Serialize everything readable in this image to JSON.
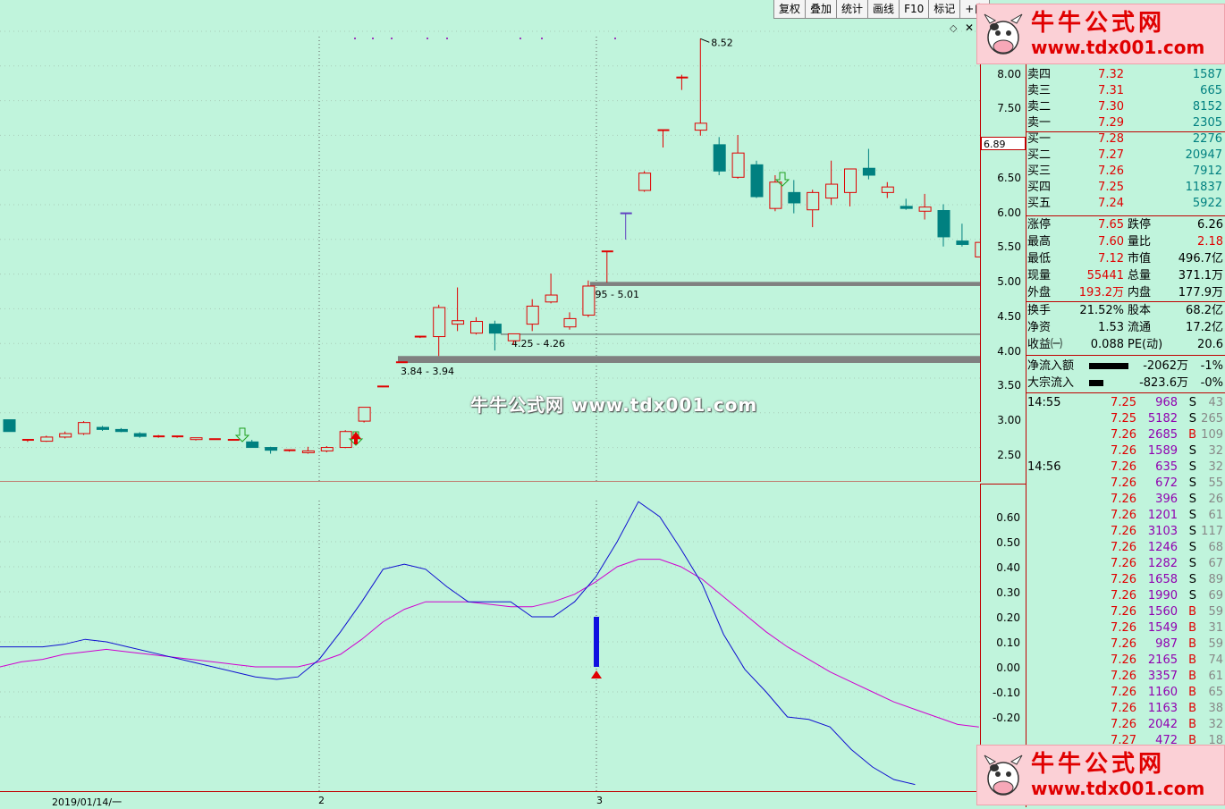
{
  "toolbar": [
    "复权",
    "叠加",
    "统计",
    "画线",
    "F10",
    "标记",
    "+自"
  ],
  "kchart": {
    "price_axis": [
      "8.00",
      "7.50",
      "7.00",
      "6.50",
      "6.00",
      "5.50",
      "5.00",
      "4.50",
      "4.00",
      "3.50",
      "3.00",
      "2.50"
    ],
    "current_price": "6.89",
    "high_label": "8.52",
    "gap_labels": [
      "4.95 - 5.01",
      "4.25 - 4.26",
      "3.84 - 3.94"
    ],
    "watermark": "牛牛公式网 www.tdx001.com"
  },
  "indicator": {
    "axis": [
      "0.60",
      "0.50",
      "0.40",
      "0.30",
      "0.20",
      "0.10",
      "0.00",
      "-0.10",
      "-0.20"
    ]
  },
  "dates": [
    "2019/01/14/一",
    "2",
    "3"
  ],
  "quote": {
    "rows": [
      {
        "label": "卖四",
        "price": "7.32",
        "vol": "1587"
      },
      {
        "label": "卖三",
        "price": "7.31",
        "vol": "665"
      },
      {
        "label": "卖二",
        "price": "7.30",
        "vol": "8152"
      },
      {
        "label": "卖一",
        "price": "7.29",
        "vol": "2305"
      },
      {
        "label": "买一",
        "price": "7.28",
        "vol": "2276"
      },
      {
        "label": "买二",
        "price": "7.27",
        "vol": "20947"
      },
      {
        "label": "买三",
        "price": "7.26",
        "vol": "7912"
      },
      {
        "label": "买四",
        "price": "7.25",
        "vol": "11837"
      },
      {
        "label": "买五",
        "price": "7.24",
        "vol": "5922"
      }
    ],
    "stats": [
      {
        "l1": "涨停",
        "v1": "7.65",
        "l2": "跌停",
        "v2": "6.26"
      },
      {
        "l1": "最高",
        "v1": "7.60",
        "l2": "量比",
        "v2": "2.18"
      },
      {
        "l1": "最低",
        "v1": "7.12",
        "l2": "市值",
        "v2": "496.7亿"
      },
      {
        "l1": "现量",
        "v1": "55441",
        "l2": "总量",
        "v2": "371.1万"
      },
      {
        "l1": "外盘",
        "v1": "193.2万",
        "l2": "内盘",
        "v2": "177.9万"
      }
    ],
    "stats2": [
      {
        "l1": "换手",
        "v1": "21.52%",
        "l2": "股本",
        "v2": "68.2亿"
      },
      {
        "l1": "净资",
        "v1": "1.53",
        "l2": "流通",
        "v2": "17.2亿"
      },
      {
        "l1": "收益㈠",
        "v1": "0.088",
        "l2": "PE(动)",
        "v2": "20.6"
      }
    ],
    "flows": [
      {
        "label": "净流入额",
        "value": "-2062万",
        "pct": "-1%"
      },
      {
        "label": "大宗流入",
        "value": "-823.6万",
        "pct": "-0%"
      }
    ]
  },
  "ticks": [
    {
      "time": "14:55",
      "price": "7.25",
      "vol": "968",
      "bs": "S",
      "n": "43"
    },
    {
      "time": "",
      "price": "7.25",
      "vol": "5182",
      "bs": "S",
      "n": "265"
    },
    {
      "time": "",
      "price": "7.26",
      "vol": "2685",
      "bs": "B",
      "n": "109"
    },
    {
      "time": "",
      "price": "7.26",
      "vol": "1589",
      "bs": "S",
      "n": "32"
    },
    {
      "time": "14:56",
      "price": "7.26",
      "vol": "635",
      "bs": "S",
      "n": "32"
    },
    {
      "time": "",
      "price": "7.26",
      "vol": "672",
      "bs": "S",
      "n": "55"
    },
    {
      "time": "",
      "price": "7.26",
      "vol": "396",
      "bs": "S",
      "n": "26"
    },
    {
      "time": "",
      "price": "7.26",
      "vol": "1201",
      "bs": "S",
      "n": "61"
    },
    {
      "time": "",
      "price": "7.26",
      "vol": "3103",
      "bs": "S",
      "n": "117"
    },
    {
      "time": "",
      "price": "7.26",
      "vol": "1246",
      "bs": "S",
      "n": "68"
    },
    {
      "time": "",
      "price": "7.26",
      "vol": "1282",
      "bs": "S",
      "n": "67"
    },
    {
      "time": "",
      "price": "7.26",
      "vol": "1658",
      "bs": "S",
      "n": "89"
    },
    {
      "time": "",
      "price": "7.26",
      "vol": "1990",
      "bs": "S",
      "n": "69"
    },
    {
      "time": "",
      "price": "7.26",
      "vol": "1560",
      "bs": "B",
      "n": "59"
    },
    {
      "time": "",
      "price": "7.26",
      "vol": "1549",
      "bs": "B",
      "n": "31"
    },
    {
      "time": "",
      "price": "7.26",
      "vol": "987",
      "bs": "B",
      "n": "59"
    },
    {
      "time": "",
      "price": "7.26",
      "vol": "2165",
      "bs": "B",
      "n": "74"
    },
    {
      "time": "",
      "price": "7.26",
      "vol": "3357",
      "bs": "B",
      "n": "61"
    },
    {
      "time": "",
      "price": "7.26",
      "vol": "1160",
      "bs": "B",
      "n": "65"
    },
    {
      "time": "",
      "price": "7.26",
      "vol": "1163",
      "bs": "B",
      "n": "38"
    },
    {
      "time": "",
      "price": "7.26",
      "vol": "2042",
      "bs": "B",
      "n": "32"
    },
    {
      "time": "",
      "price": "7.27",
      "vol": "472",
      "bs": "B",
      "n": "18"
    }
  ],
  "watermark": {
    "title": "牛牛公式网",
    "url": "www.tdx001.com"
  },
  "candles": [
    {
      "o": 3.02,
      "h": 3.02,
      "l": 2.85,
      "c": 2.85
    },
    {
      "o": 2.72,
      "h": 2.74,
      "l": 2.7,
      "c": 2.73
    },
    {
      "o": 2.71,
      "h": 2.79,
      "l": 2.7,
      "c": 2.77
    },
    {
      "o": 2.77,
      "h": 2.85,
      "l": 2.75,
      "c": 2.82
    },
    {
      "o": 2.82,
      "h": 3.0,
      "l": 2.8,
      "c": 2.98
    },
    {
      "o": 2.91,
      "h": 2.93,
      "l": 2.86,
      "c": 2.88
    },
    {
      "o": 2.88,
      "h": 2.9,
      "l": 2.84,
      "c": 2.85
    },
    {
      "o": 2.82,
      "h": 2.84,
      "l": 2.76,
      "c": 2.78
    },
    {
      "o": 2.78,
      "h": 2.8,
      "l": 2.76,
      "c": 2.78
    },
    {
      "o": 2.78,
      "h": 2.79,
      "l": 2.76,
      "c": 2.78
    },
    {
      "o": 2.74,
      "h": 2.76,
      "l": 2.72,
      "c": 2.76
    },
    {
      "o": 2.74,
      "h": 2.75,
      "l": 2.73,
      "c": 2.74
    },
    {
      "o": 2.73,
      "h": 2.74,
      "l": 2.72,
      "c": 2.73
    },
    {
      "o": 2.7,
      "h": 2.73,
      "l": 2.62,
      "c": 2.62
    },
    {
      "o": 2.62,
      "h": 2.63,
      "l": 2.53,
      "c": 2.58
    },
    {
      "o": 2.57,
      "h": 2.59,
      "l": 2.56,
      "c": 2.58
    },
    {
      "o": 2.55,
      "h": 2.63,
      "l": 2.53,
      "c": 2.57
    },
    {
      "o": 2.57,
      "h": 2.64,
      "l": 2.55,
      "c": 2.62
    },
    {
      "o": 2.62,
      "h": 2.87,
      "l": 2.61,
      "c": 2.85
    },
    {
      "o": 3.0,
      "h": 3.2,
      "l": 2.98,
      "c": 3.2
    },
    {
      "o": 3.49,
      "h": 3.5,
      "l": 3.49,
      "c": 3.5
    },
    {
      "o": 3.85,
      "h": 3.86,
      "l": 3.84,
      "c": 3.85
    },
    {
      "o": 4.22,
      "h": 4.23,
      "l": 4.2,
      "c": 4.22
    },
    {
      "o": 4.22,
      "h": 4.68,
      "l": 3.94,
      "c": 4.64
    },
    {
      "o": 4.4,
      "h": 4.93,
      "l": 4.3,
      "c": 4.45
    },
    {
      "o": 4.27,
      "h": 4.5,
      "l": 4.25,
      "c": 4.44
    },
    {
      "o": 4.4,
      "h": 4.45,
      "l": 4.02,
      "c": 4.27
    },
    {
      "o": 4.16,
      "h": 4.26,
      "l": 4.1,
      "c": 4.26
    },
    {
      "o": 4.4,
      "h": 4.76,
      "l": 4.3,
      "c": 4.66
    },
    {
      "o": 4.72,
      "h": 5.13,
      "l": 4.7,
      "c": 4.82
    },
    {
      "o": 4.36,
      "h": 4.57,
      "l": 4.32,
      "c": 4.48
    },
    {
      "o": 4.53,
      "h": 5.03,
      "l": 4.5,
      "c": 4.95
    },
    {
      "o": 5.45,
      "h": 5.45,
      "l": 5.0,
      "c": 5.45
    },
    {
      "o": 6.0,
      "h": 6.0,
      "l": 5.62,
      "c": 6.0
    },
    {
      "o": 6.33,
      "h": 6.61,
      "l": 6.31,
      "c": 6.58
    },
    {
      "o": 7.2,
      "h": 7.2,
      "l": 6.95,
      "c": 7.2
    },
    {
      "o": 7.96,
      "h": 8.0,
      "l": 7.78,
      "c": 7.96
    },
    {
      "o": 7.2,
      "h": 8.52,
      "l": 7.12,
      "c": 7.3
    },
    {
      "o": 6.99,
      "h": 7.1,
      "l": 6.55,
      "c": 6.61
    },
    {
      "o": 6.52,
      "h": 7.13,
      "l": 6.5,
      "c": 6.87
    },
    {
      "o": 6.7,
      "h": 6.76,
      "l": 6.22,
      "c": 6.24
    },
    {
      "o": 6.07,
      "h": 6.55,
      "l": 6.03,
      "c": 6.45
    },
    {
      "o": 6.3,
      "h": 6.48,
      "l": 6.0,
      "c": 6.15
    },
    {
      "o": 6.05,
      "h": 6.34,
      "l": 5.8,
      "c": 6.3
    },
    {
      "o": 6.22,
      "h": 6.76,
      "l": 6.12,
      "c": 6.42
    },
    {
      "o": 6.3,
      "h": 6.64,
      "l": 6.1,
      "c": 6.64
    },
    {
      "o": 6.65,
      "h": 6.93,
      "l": 6.49,
      "c": 6.55
    },
    {
      "o": 6.3,
      "h": 6.45,
      "l": 6.22,
      "c": 6.38
    },
    {
      "o": 6.1,
      "h": 6.21,
      "l": 6.05,
      "c": 6.07
    },
    {
      "o": 6.03,
      "h": 6.28,
      "l": 5.91,
      "c": 6.09
    },
    {
      "o": 6.04,
      "h": 6.13,
      "l": 5.52,
      "c": 5.66
    },
    {
      "o": 5.6,
      "h": 5.85,
      "l": 5.52,
      "c": 5.55
    },
    {
      "o": 5.37,
      "h": 5.68,
      "l": 5.14,
      "c": 5.58
    }
  ],
  "gap_bands": [
    {
      "lo": 3.84,
      "hi": 3.94
    },
    {
      "lo": 4.25,
      "hi": 4.26
    },
    {
      "lo": 4.95,
      "hi": 5.01
    }
  ],
  "ind_blue": [
    0.08,
    0.08,
    0.08,
    0.09,
    0.11,
    0.1,
    0.08,
    0.06,
    0.04,
    0.02,
    0.0,
    -0.02,
    -0.04,
    -0.05,
    -0.04,
    0.03,
    0.14,
    0.26,
    0.39,
    0.41,
    0.39,
    0.32,
    0.26,
    0.26,
    0.26,
    0.2,
    0.2,
    0.26,
    0.36,
    0.5,
    0.66,
    0.6,
    0.47,
    0.33,
    0.13,
    -0.01,
    -0.1,
    -0.2,
    -0.21,
    -0.24,
    -0.33,
    -0.4,
    -0.45,
    -0.47
  ],
  "ind_magenta": [
    0.0,
    0.02,
    0.03,
    0.05,
    0.06,
    0.07,
    0.06,
    0.05,
    0.04,
    0.03,
    0.02,
    0.01,
    0.0,
    0.0,
    0.0,
    0.02,
    0.05,
    0.11,
    0.18,
    0.23,
    0.26,
    0.26,
    0.26,
    0.25,
    0.24,
    0.24,
    0.26,
    0.29,
    0.34,
    0.4,
    0.43,
    0.43,
    0.4,
    0.35,
    0.28,
    0.21,
    0.14,
    0.08,
    0.03,
    -0.02,
    -0.06,
    -0.1,
    -0.14,
    -0.17,
    -0.2,
    -0.23,
    -0.24
  ]
}
